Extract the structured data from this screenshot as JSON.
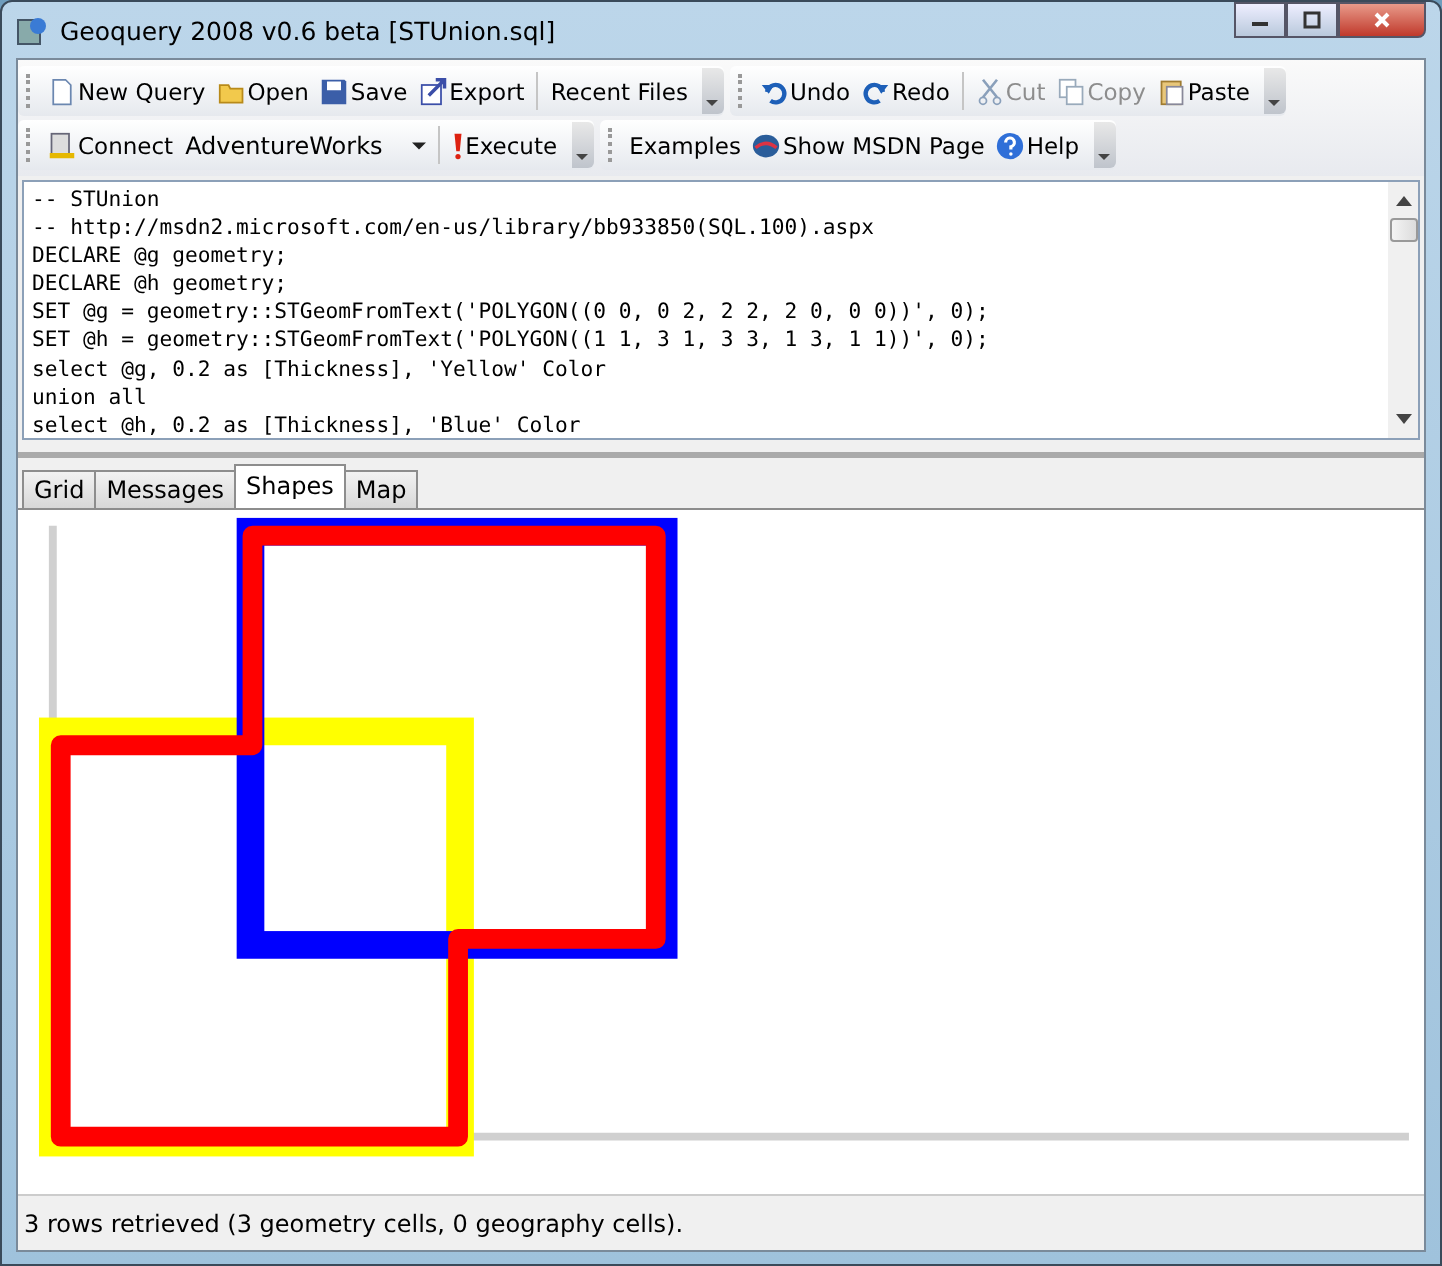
{
  "window": {
    "title": "Geoquery 2008 v0.6 beta [STUnion.sql]"
  },
  "toolbar_rows": [
    [
      {
        "items": [
          {
            "kind": "button",
            "label": "New Query",
            "disabled": false
          },
          {
            "kind": "button",
            "label": "Open",
            "disabled": false
          },
          {
            "kind": "button",
            "label": "Save",
            "disabled": false
          },
          {
            "kind": "button",
            "label": "Export",
            "disabled": false
          },
          {
            "kind": "separator"
          },
          {
            "kind": "button",
            "label": "Recent Files",
            "disabled": false
          }
        ]
      },
      {
        "items": [
          {
            "kind": "button",
            "label": "Undo",
            "disabled": false
          },
          {
            "kind": "button",
            "label": "Redo",
            "disabled": false
          },
          {
            "kind": "separator"
          },
          {
            "kind": "button",
            "label": "Cut",
            "disabled": true
          },
          {
            "kind": "button",
            "label": "Copy",
            "disabled": true
          },
          {
            "kind": "button",
            "label": "Paste",
            "disabled": false
          }
        ]
      }
    ],
    [
      {
        "items": [
          {
            "kind": "button",
            "label": "Connect",
            "disabled": false
          },
          {
            "kind": "dropdown",
            "value": "AdventureWorks"
          },
          {
            "kind": "separator"
          },
          {
            "kind": "button",
            "label": "Execute",
            "disabled": false
          }
        ]
      },
      {
        "items": [
          {
            "kind": "button",
            "label": "Examples",
            "disabled": false
          },
          {
            "kind": "button",
            "label": "Show MSDN Page",
            "disabled": false
          },
          {
            "kind": "button",
            "label": "Help",
            "disabled": false
          }
        ]
      }
    ]
  ],
  "editor": {
    "lines": [
      "-- STUnion",
      "-- http://msdn2.microsoft.com/en-us/library/bb933850(SQL.100).aspx",
      "DECLARE @g geometry;",
      "DECLARE @h geometry;",
      "SET @g = geometry::STGeomFromText('POLYGON((0 0, 0 2, 2 2, 2 0, 0 0))', 0);",
      "SET @h = geometry::STGeomFromText('POLYGON((1 1, 3 1, 3 3, 1 3, 1 1))', 0);",
      "select @g, 0.2 as [Thickness], 'Yellow' Color",
      "union all",
      "select @h, 0.2 as [Thickness], 'Blue' Color"
    ]
  },
  "tabs": [
    {
      "label": "Grid",
      "selected": false
    },
    {
      "label": "Messages",
      "selected": false
    },
    {
      "label": "Shapes",
      "selected": true
    },
    {
      "label": "Map",
      "selected": false
    }
  ],
  "status_bar": {
    "text": "3 rows retrieved (3 geometry cells, 0 geography cells)."
  }
}
